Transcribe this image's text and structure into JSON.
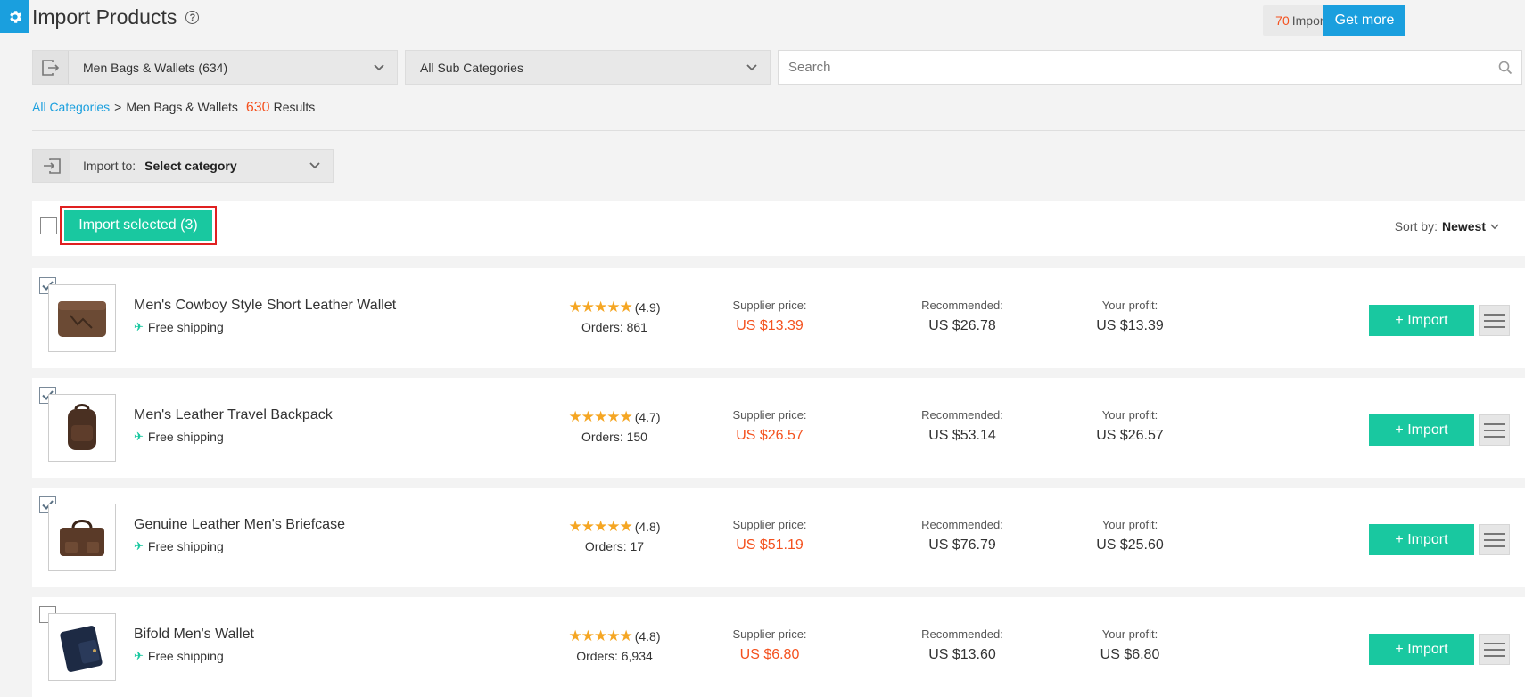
{
  "header": {
    "title": "Import Products",
    "help_icon": "question-icon",
    "imports_left_count": "70",
    "imports_left_label": "Imports left",
    "get_more_label": "Get more"
  },
  "filters": {
    "category": "Men Bags & Wallets (634)",
    "sub_category": "All Sub Categories",
    "search_placeholder": "Search"
  },
  "breadcrumb": {
    "root": "All Categories",
    "separator": ">",
    "current": "Men Bags & Wallets",
    "result_count": "630",
    "results_label": "Results"
  },
  "import_to": {
    "label": "Import to:",
    "value": "Select category"
  },
  "toolbar": {
    "import_selected_label": "Import selected (3)",
    "sort_label": "Sort by:",
    "sort_value": "Newest"
  },
  "product_labels": {
    "supplier": "Supplier price:",
    "recommended": "Recommended:",
    "profit": "Your profit:",
    "import_button": "+ Import",
    "shipping": "Free shipping",
    "stars": "★★★★★"
  },
  "products": [
    {
      "name": "Men's Cowboy Style Short Leather Wallet",
      "rating": "(4.9)",
      "orders": "Orders: 861",
      "supplier_price": "US $13.39",
      "recommended": "US $26.78",
      "profit": "US $13.39",
      "checked": true
    },
    {
      "name": "Men's Leather Travel Backpack",
      "rating": "(4.7)",
      "orders": "Orders: 150",
      "supplier_price": "US $26.57",
      "recommended": "US $53.14",
      "profit": "US $26.57",
      "checked": true
    },
    {
      "name": "Genuine Leather Men's Briefcase",
      "rating": "(4.8)",
      "orders": "Orders: 17",
      "supplier_price": "US $51.19",
      "recommended": "US $76.79",
      "profit": "US $25.60",
      "checked": true
    },
    {
      "name": "Bifold Men's Wallet",
      "rating": "(4.8)",
      "orders": "Orders: 6,934",
      "supplier_price": "US $6.80",
      "recommended": "US $13.60",
      "profit": "US $6.80",
      "checked": false
    }
  ],
  "colors": {
    "accent_blue": "#1a9fde",
    "accent_green": "#19c8a0",
    "price_red": "#f4511e",
    "highlight_border": "#e02020"
  }
}
